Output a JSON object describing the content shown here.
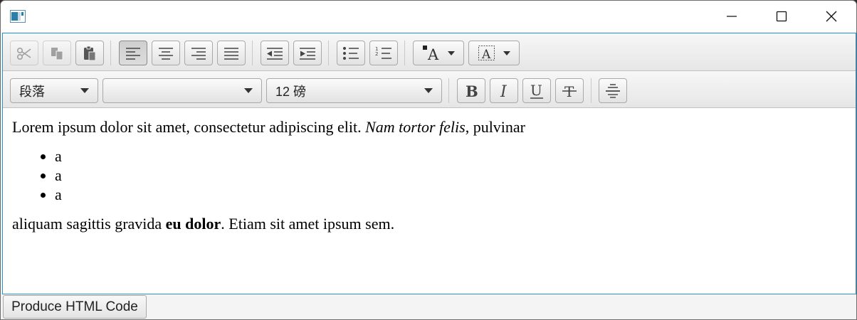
{
  "titlebar": {
    "minimize_icon": "minimize-icon",
    "maximize_icon": "maximize-icon",
    "close_icon": "close-icon"
  },
  "toolbar_top": [
    {
      "name": "cut",
      "icon": "scissors-icon",
      "enabled": false
    },
    {
      "name": "copy",
      "icon": "copy-icon",
      "enabled": false
    },
    {
      "name": "paste",
      "icon": "clipboard-icon",
      "enabled": true
    },
    {
      "name": "align-left",
      "icon": "align-left-icon",
      "selected": true
    },
    {
      "name": "align-center",
      "icon": "align-center-icon"
    },
    {
      "name": "align-right",
      "icon": "align-right-icon"
    },
    {
      "name": "align-justify",
      "icon": "align-justify-icon"
    },
    {
      "name": "outdent",
      "icon": "outdent-icon"
    },
    {
      "name": "indent",
      "icon": "indent-icon"
    },
    {
      "name": "bullets",
      "icon": "bullet-list-icon"
    },
    {
      "name": "numbers",
      "icon": "numbered-list-icon"
    },
    {
      "name": "text-color",
      "icon": "text-color-icon"
    },
    {
      "name": "highlight",
      "icon": "background-color-icon"
    }
  ],
  "toolbar_bottom": {
    "paragraph_format": "段落",
    "font_family": "",
    "font_size": "12 磅",
    "buttons": [
      {
        "name": "bold",
        "icon": "bold-icon"
      },
      {
        "name": "italic",
        "icon": "italic-icon"
      },
      {
        "name": "underline",
        "icon": "underline-icon"
      },
      {
        "name": "strikethrough",
        "icon": "strikethrough-icon"
      },
      {
        "name": "insert-hr",
        "icon": "horizontal-rule-icon"
      }
    ]
  },
  "content": {
    "p1_plain": "Lorem ipsum dolor sit amet, consectetur adipiscing elit. ",
    "p1_italic": "Nam tortor felis",
    "p1_tail": ", pulvinar",
    "list": [
      "a",
      "a",
      "a"
    ],
    "p2_plain": "aliquam sagittis gravida ",
    "p2_bold": "eu dolor",
    "p2_tail": ". Etiam sit amet ipsum sem."
  },
  "footer": {
    "produce_label": "Produce HTML Code"
  }
}
